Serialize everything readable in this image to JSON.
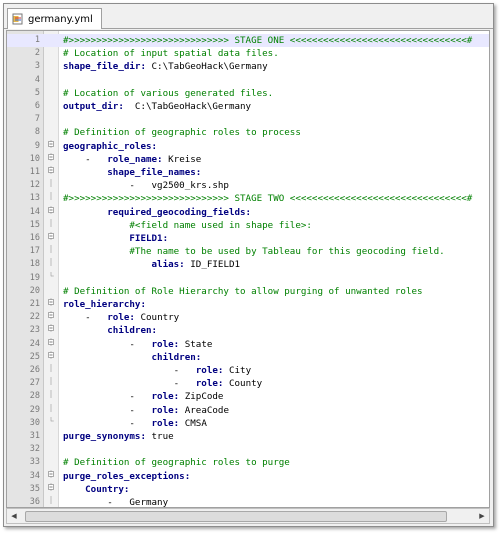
{
  "tab": {
    "label": "germany.yml",
    "icon": "yml-file-icon"
  },
  "colors": {
    "key": "#000080",
    "comment": "#008000",
    "value": "#000000",
    "gutter": "#e4e4e4"
  },
  "lines": [
    {
      "n": "1",
      "fold": "none",
      "hl": true,
      "seg": [
        {
          "t": "#>>>>>>>>>>>>>>>>>>>>>>>>>>>>> STAGE ONE <<<<<<<<<<<<<<<<<<<<<<<<<<<<<<<<#",
          "c": "c"
        }
      ]
    },
    {
      "n": "2",
      "fold": "none",
      "seg": [
        {
          "t": "# Location of input spatial data files.",
          "c": "c"
        }
      ]
    },
    {
      "n": "3",
      "fold": "none",
      "seg": [
        {
          "t": "shape_file_dir:",
          "c": "k"
        },
        {
          "t": " C:\\TabGeoHack\\Germany",
          "c": "v"
        }
      ]
    },
    {
      "n": "4",
      "fold": "none",
      "seg": []
    },
    {
      "n": "5",
      "fold": "none",
      "seg": [
        {
          "t": "# Location of various generated files.",
          "c": "c"
        }
      ]
    },
    {
      "n": "6",
      "fold": "none",
      "seg": [
        {
          "t": "output_dir:",
          "c": "k"
        },
        {
          "t": "  C:\\TabGeoHack\\Germany",
          "c": "v"
        }
      ]
    },
    {
      "n": "7",
      "fold": "none",
      "seg": []
    },
    {
      "n": "8",
      "fold": "none",
      "seg": [
        {
          "t": "# Definition of geographic roles to process",
          "c": "c"
        }
      ]
    },
    {
      "n": "9",
      "fold": "box",
      "seg": [
        {
          "t": "geographic_roles:",
          "c": "k"
        }
      ]
    },
    {
      "n": "10",
      "fold": "box",
      "seg": [
        {
          "t": "    -   ",
          "c": "p"
        },
        {
          "t": "role_name:",
          "c": "k"
        },
        {
          "t": " Kreise",
          "c": "v"
        }
      ]
    },
    {
      "n": "11",
      "fold": "box",
      "seg": [
        {
          "t": "        ",
          "c": "p"
        },
        {
          "t": "shape_file_names:",
          "c": "k"
        }
      ]
    },
    {
      "n": "12",
      "fold": "bar",
      "seg": [
        {
          "t": "            -   vg2500_krs.shp",
          "c": "v"
        }
      ]
    },
    {
      "n": "13",
      "fold": "bar",
      "seg": [
        {
          "t": "#>>>>>>>>>>>>>>>>>>>>>>>>>>>>> STAGE TWO <<<<<<<<<<<<<<<<<<<<<<<<<<<<<<<<#",
          "c": "c"
        }
      ]
    },
    {
      "n": "14",
      "fold": "box",
      "seg": [
        {
          "t": "        ",
          "c": "p"
        },
        {
          "t": "required_geocoding_fields:",
          "c": "k"
        }
      ]
    },
    {
      "n": "15",
      "fold": "bar",
      "seg": [
        {
          "t": "            #<field name used in shape file>:",
          "c": "c"
        }
      ]
    },
    {
      "n": "16",
      "fold": "box",
      "seg": [
        {
          "t": "            ",
          "c": "p"
        },
        {
          "t": "FIELD1:",
          "c": "k"
        }
      ]
    },
    {
      "n": "17",
      "fold": "bar",
      "seg": [
        {
          "t": "            #The name to be used by Tableau for this geocoding field.",
          "c": "c"
        }
      ]
    },
    {
      "n": "18",
      "fold": "bar",
      "seg": [
        {
          "t": "                ",
          "c": "p"
        },
        {
          "t": "alias:",
          "c": "k"
        },
        {
          "t": " ID_FIELD1",
          "c": "v"
        }
      ]
    },
    {
      "n": "19",
      "fold": "end",
      "seg": []
    },
    {
      "n": "20",
      "fold": "none",
      "seg": [
        {
          "t": "# Definition of Role Hierarchy to allow purging of unwanted roles",
          "c": "c"
        }
      ]
    },
    {
      "n": "21",
      "fold": "box",
      "seg": [
        {
          "t": "role_hierarchy:",
          "c": "k"
        }
      ]
    },
    {
      "n": "22",
      "fold": "box",
      "seg": [
        {
          "t": "    -   ",
          "c": "p"
        },
        {
          "t": "role:",
          "c": "k"
        },
        {
          "t": " Country",
          "c": "v"
        }
      ]
    },
    {
      "n": "23",
      "fold": "box",
      "seg": [
        {
          "t": "        ",
          "c": "p"
        },
        {
          "t": "children:",
          "c": "k"
        }
      ]
    },
    {
      "n": "24",
      "fold": "box",
      "seg": [
        {
          "t": "            -   ",
          "c": "p"
        },
        {
          "t": "role:",
          "c": "k"
        },
        {
          "t": " State",
          "c": "v"
        }
      ]
    },
    {
      "n": "25",
      "fold": "box",
      "seg": [
        {
          "t": "                ",
          "c": "p"
        },
        {
          "t": "children:",
          "c": "k"
        }
      ]
    },
    {
      "n": "26",
      "fold": "bar",
      "seg": [
        {
          "t": "                    -   ",
          "c": "p"
        },
        {
          "t": "role:",
          "c": "k"
        },
        {
          "t": " City",
          "c": "v"
        }
      ]
    },
    {
      "n": "27",
      "fold": "bar",
      "seg": [
        {
          "t": "                    -   ",
          "c": "p"
        },
        {
          "t": "role:",
          "c": "k"
        },
        {
          "t": " County",
          "c": "v"
        }
      ]
    },
    {
      "n": "28",
      "fold": "bar",
      "seg": [
        {
          "t": "            -   ",
          "c": "p"
        },
        {
          "t": "role:",
          "c": "k"
        },
        {
          "t": " ZipCode",
          "c": "v"
        }
      ]
    },
    {
      "n": "29",
      "fold": "bar",
      "seg": [
        {
          "t": "            -   ",
          "c": "p"
        },
        {
          "t": "role:",
          "c": "k"
        },
        {
          "t": " AreaCode",
          "c": "v"
        }
      ]
    },
    {
      "n": "30",
      "fold": "end",
      "seg": [
        {
          "t": "            -   ",
          "c": "p"
        },
        {
          "t": "role:",
          "c": "k"
        },
        {
          "t": " CMSA",
          "c": "v"
        }
      ]
    },
    {
      "n": "31",
      "fold": "none",
      "seg": [
        {
          "t": "purge_synonyms:",
          "c": "k"
        },
        {
          "t": " true",
          "c": "v"
        }
      ]
    },
    {
      "n": "32",
      "fold": "none",
      "seg": []
    },
    {
      "n": "33",
      "fold": "none",
      "seg": [
        {
          "t": "# Definition of geographic roles to purge",
          "c": "c"
        }
      ]
    },
    {
      "n": "34",
      "fold": "box",
      "seg": [
        {
          "t": "purge_roles_exceptions:",
          "c": "k"
        }
      ]
    },
    {
      "n": "35",
      "fold": "box",
      "seg": [
        {
          "t": "    ",
          "c": "p"
        },
        {
          "t": "Country:",
          "c": "k"
        }
      ]
    },
    {
      "n": "36",
      "fold": "bar",
      "seg": [
        {
          "t": "        -   Germany",
          "c": "v"
        }
      ]
    }
  ]
}
